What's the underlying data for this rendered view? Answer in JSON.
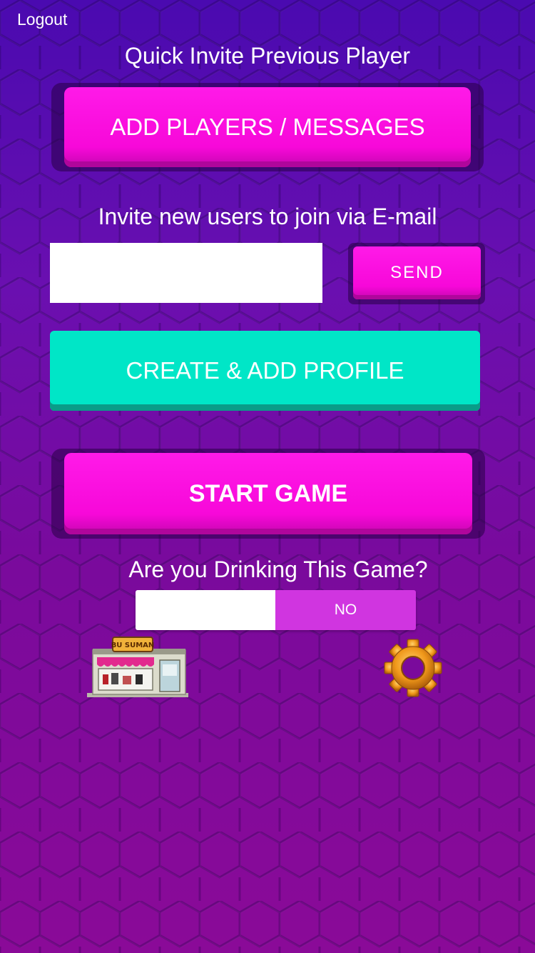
{
  "header": {
    "logout_label": "Logout",
    "quick_invite_title": "Quick Invite Previous Player"
  },
  "buttons": {
    "add_players_label": "ADD PLAYERS / MESSAGES",
    "send_label": "SEND",
    "create_profile_label": "CREATE & ADD PROFILE",
    "start_game_label": "START GAME"
  },
  "invite": {
    "label": "Invite new users to join via E-mail",
    "email_value": "",
    "email_placeholder": ""
  },
  "drinking": {
    "question": "Are you Drinking This Game?",
    "toggle_value": "NO"
  },
  "shop": {
    "sign_text": "BU SUMAN"
  },
  "icons": {
    "shop": "shop-icon",
    "settings": "gear-icon"
  },
  "colors": {
    "background_top": "#4a0ab0",
    "background_bottom": "#8a0a98",
    "accent_pink": "#f708d9",
    "accent_teal": "#00e6c7",
    "toggle_no": "#d035e0",
    "gear_orange": "#f0981a"
  }
}
